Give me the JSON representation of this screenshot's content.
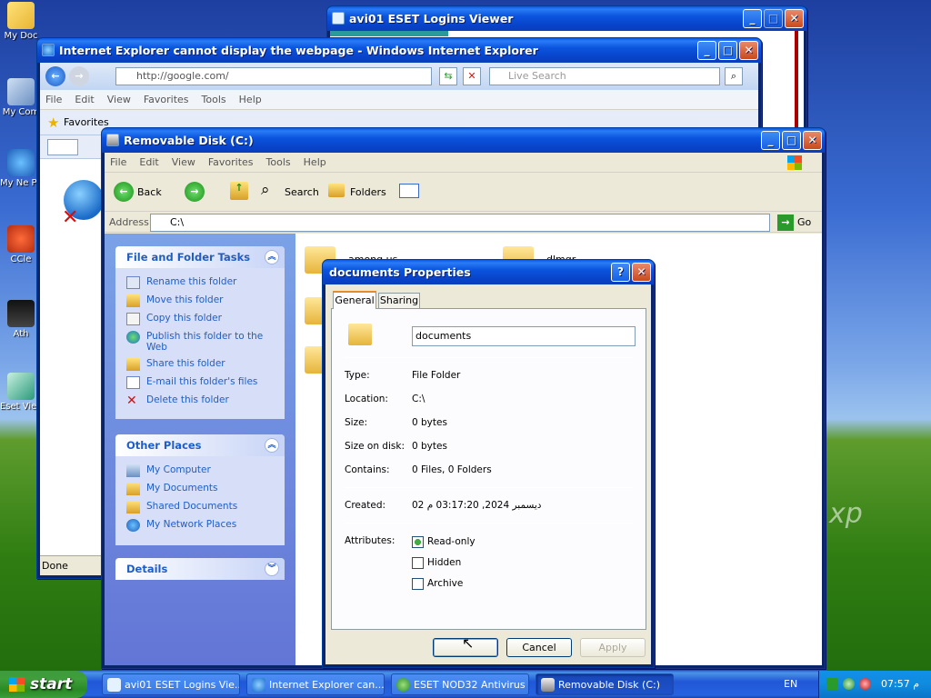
{
  "desktop": {
    "icons": [
      {
        "label": "My Doc",
        "icon": "my-documents-icon"
      },
      {
        "label": "My Com",
        "icon": "my-computer-icon"
      },
      {
        "label": "My Ne Plac",
        "icon": "network-places-icon"
      },
      {
        "label": "CCle",
        "icon": "ccleaner-icon"
      },
      {
        "label": "Ath",
        "icon": "app-shortcut-icon"
      },
      {
        "label": "Eset Viev",
        "icon": "eset-viewer-icon"
      }
    ],
    "xp_mark": "xp"
  },
  "eset_window": {
    "title": "avi01 ESET Logins Viewer"
  },
  "ie_window": {
    "title": "Internet Explorer cannot display the webpage - Windows Internet Explorer",
    "address": "http://google.com/",
    "search_placeholder": "Live Search",
    "menu": [
      "File",
      "Edit",
      "View",
      "Favorites",
      "Tools",
      "Help"
    ],
    "favorites_label": "Favorites",
    "status": "Done"
  },
  "explorer": {
    "title": "Removable Disk (C:)",
    "menu": [
      "File",
      "Edit",
      "View",
      "Favorites",
      "Tools",
      "Help"
    ],
    "toolbar": {
      "back": "Back",
      "search": "Search",
      "folders": "Folders"
    },
    "address_label": "Address",
    "address": "C:\\",
    "go": "Go",
    "file_tasks": {
      "title": "File and Folder Tasks",
      "items": [
        "Rename this folder",
        "Move this folder",
        "Copy this folder",
        "Publish this folder to the Web",
        "Share this folder",
        "E-mail this folder's files",
        "Delete this folder"
      ]
    },
    "other_places": {
      "title": "Other Places",
      "items": [
        "My Computer",
        "My Documents",
        "Shared Documents",
        "My Network Places"
      ]
    },
    "details": {
      "title": "Details"
    },
    "folders": [
      {
        "name": "among us"
      },
      {
        "name": "dlmgr"
      }
    ]
  },
  "dialog": {
    "title": "documents Properties",
    "tabs": [
      "General",
      "Sharing"
    ],
    "name": "documents",
    "type_label": "Type:",
    "type": "File Folder",
    "location_label": "Location:",
    "location": "C:\\",
    "size_label": "Size:",
    "size": "0 bytes",
    "size_on_disk_label": "Size on disk:",
    "size_on_disk": "0 bytes",
    "contains_label": "Contains:",
    "contains": "0 Files, 0 Folders",
    "created_label": "Created:",
    "created": "02 ديسمبر 2024, 03:17:20 م",
    "attributes_label": "Attributes:",
    "attributes": [
      {
        "label": "Read-only",
        "state": "partial"
      },
      {
        "label": "Hidden",
        "state": "unchecked"
      },
      {
        "label": "Archive",
        "state": "unchecked"
      }
    ],
    "buttons": {
      "ok": "",
      "cancel": "Cancel",
      "apply": "Apply"
    }
  },
  "taskbar": {
    "start": "start",
    "buttons": [
      {
        "label": "avi01 ESET Logins Vie...",
        "icon": "eset-icon"
      },
      {
        "label": "Internet Explorer can...",
        "icon": "ie-icon"
      },
      {
        "label": "ESET NOD32 Antivirus",
        "icon": "nod32-icon"
      },
      {
        "label": "Removable Disk (C:)",
        "icon": "drive-icon",
        "active": true
      }
    ],
    "language": "EN",
    "clock": "07:57 م"
  }
}
